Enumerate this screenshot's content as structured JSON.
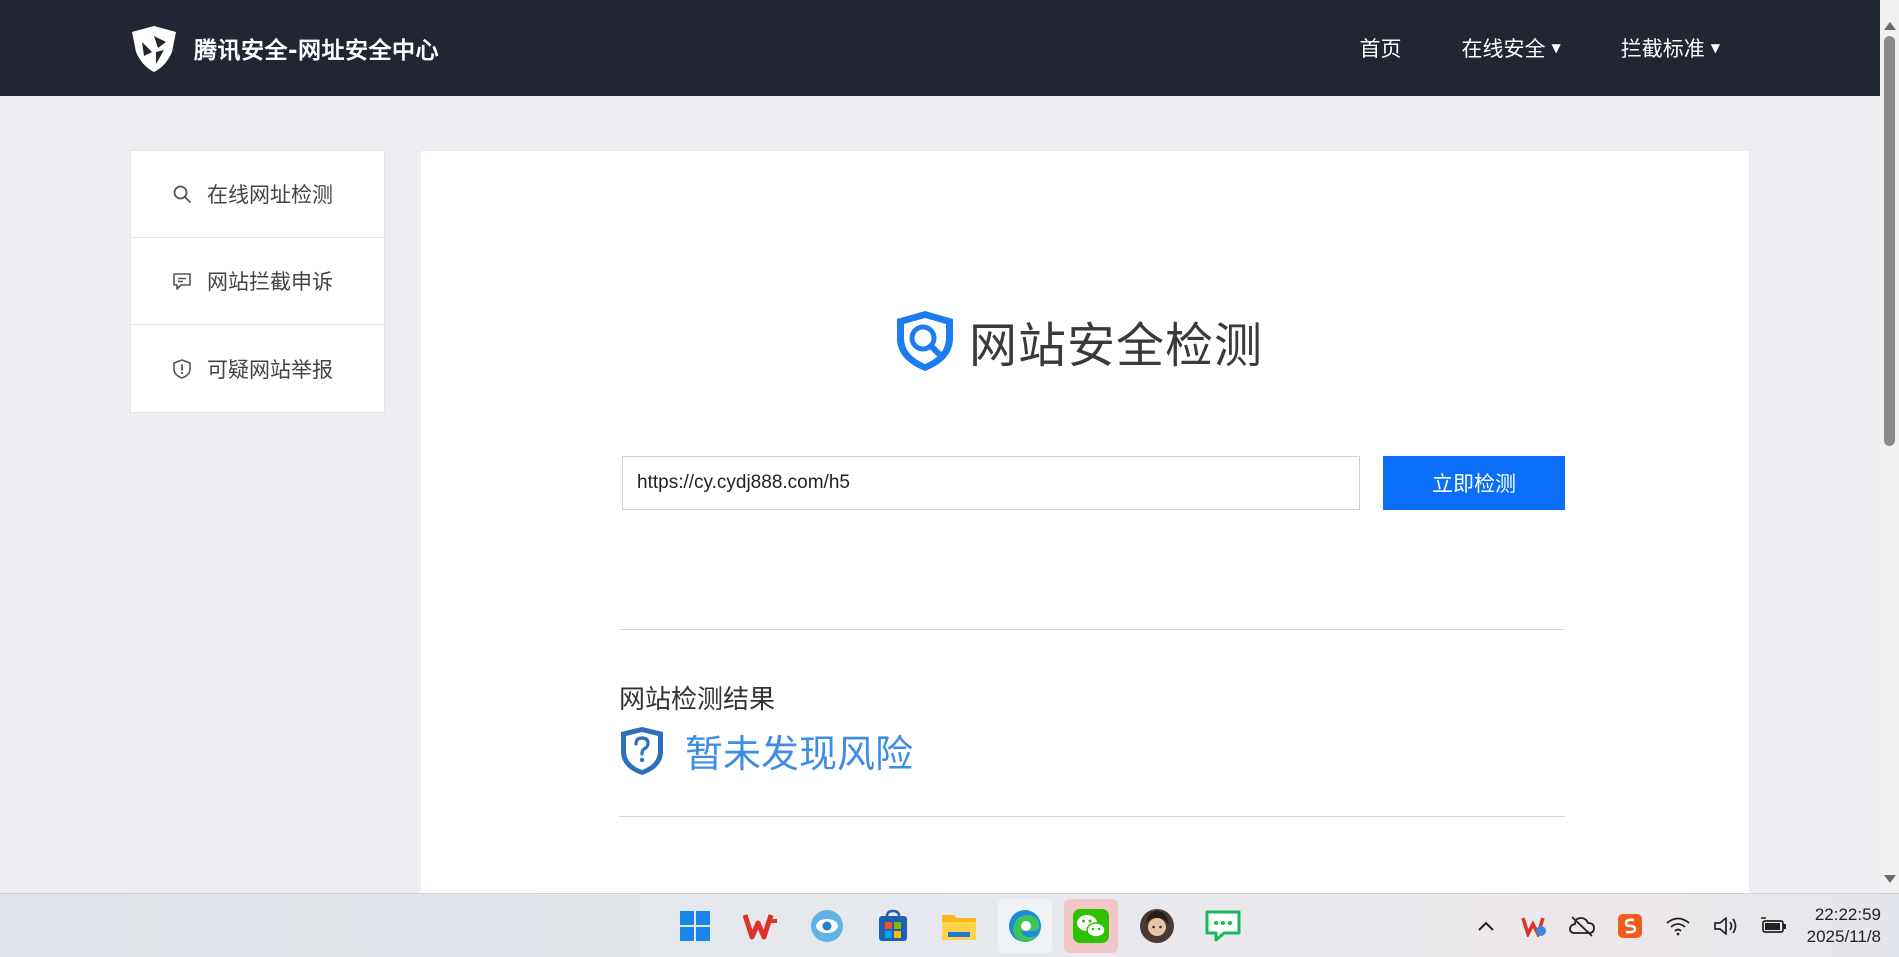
{
  "header": {
    "brand_title": "腾讯安全-网址安全中心",
    "nav": [
      {
        "label": "首页",
        "dropdown": false
      },
      {
        "label": "在线安全",
        "dropdown": true
      },
      {
        "label": "拦截标准",
        "dropdown": true
      }
    ]
  },
  "sidebar": {
    "items": [
      {
        "label": "在线网址检测",
        "icon": "search-icon"
      },
      {
        "label": "网站拦截申诉",
        "icon": "message-icon"
      },
      {
        "label": "可疑网站举报",
        "icon": "shield-alert-icon"
      }
    ]
  },
  "main": {
    "hero_title": "网站安全检测",
    "url_value": "https://cy.cydj888.com/h5",
    "check_button": "立即检测",
    "result_heading": "网站检测结果",
    "result_status": "暂未发现风险"
  },
  "taskbar": {
    "apps": [
      "windows-start-icon",
      "wps-icon",
      "eye-app-icon",
      "store-icon",
      "file-explorer-icon",
      "edge-icon",
      "wechat-icon",
      "avatar-app-icon",
      "chat-app-icon"
    ],
    "tray": [
      "chevron-up-icon",
      "wps-cloud-icon",
      "cloud-off-icon",
      "sogou-input-icon",
      "wifi-icon",
      "volume-icon",
      "battery-icon"
    ],
    "time": "22:22:59",
    "date": "2025/11/8"
  },
  "colors": {
    "navbar": "#222633",
    "primary_button": "#0b6ef9",
    "result_blue": "#3d8de4",
    "page_bg": "#eeeef2"
  }
}
